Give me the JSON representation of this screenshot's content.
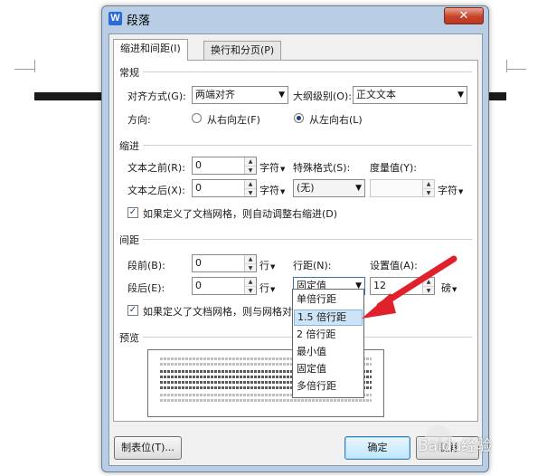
{
  "dialog": {
    "title": "段落",
    "app_icon": "W",
    "close_glyph": "✕",
    "tabs": [
      {
        "label": "缩进和间距(I)",
        "active": true
      },
      {
        "label": "换行和分页(P)",
        "active": false
      }
    ]
  },
  "general": {
    "header": "常规",
    "alignment_label": "对齐方式(G):",
    "alignment_value": "两端对齐",
    "outline_label": "大纲级别(O):",
    "outline_value": "正文文本",
    "direction_label": "方向:",
    "rtl_label": "从右向左(F)",
    "ltr_label": "从左向右(L)",
    "direction_selected": "ltr"
  },
  "indent": {
    "header": "缩进",
    "before_label": "文本之前(R):",
    "before_value": "0",
    "before_unit": "字符",
    "after_label": "文本之后(X):",
    "after_value": "0",
    "after_unit": "字符",
    "special_label": "特殊格式(S):",
    "special_value": "(无)",
    "measure_label": "度量值(Y):",
    "measure_value": "",
    "measure_unit": "字符",
    "auto_adjust_label": "如果定义了文档网格，则自动调整右缩进(D)",
    "auto_adjust_checked": true
  },
  "spacing": {
    "header": "间距",
    "before_label": "段前(B):",
    "before_value": "0",
    "before_unit": "行",
    "after_label": "段后(E):",
    "after_value": "0",
    "after_unit": "行",
    "line_spacing_label": "行距(N):",
    "line_spacing_value": "固定值",
    "set_value_label": "设置值(A):",
    "set_value": "12",
    "set_value_unit": "磅",
    "snap_grid_label": "如果定义了文档网格，则与网格对齐",
    "snap_grid_checked": true
  },
  "line_spacing_options": [
    "单倍行距",
    "1.5 倍行距",
    "2 倍行距",
    "最小值",
    "固定值",
    "多倍行距"
  ],
  "line_spacing_hovered": "1.5 倍行距",
  "preview": {
    "header": "预览",
    "sample_top": "前一段落前一段落前一段落前一段落前一段落前一段落前一段落",
    "sample_mid": "示例文字示例文字示例文字示例文字示例文字示例文字示例文字"
  },
  "buttons": {
    "tabs_label": "制表位(T)...",
    "ok_label": "确定",
    "cancel_label": "取消"
  },
  "watermark": "Baidu经验",
  "colors": {
    "title_bar": "#b9cde4",
    "close_button": "#c7432a",
    "hover_highlight": "#cde4f7",
    "annotation_arrow": "#e0202a"
  },
  "icons": {
    "app": "wps-writer-icon",
    "dropdown": "chevron-down-icon",
    "spin_up": "spin-up-icon",
    "spin_down": "spin-down-icon",
    "annotation": "red-arrow-icon"
  }
}
